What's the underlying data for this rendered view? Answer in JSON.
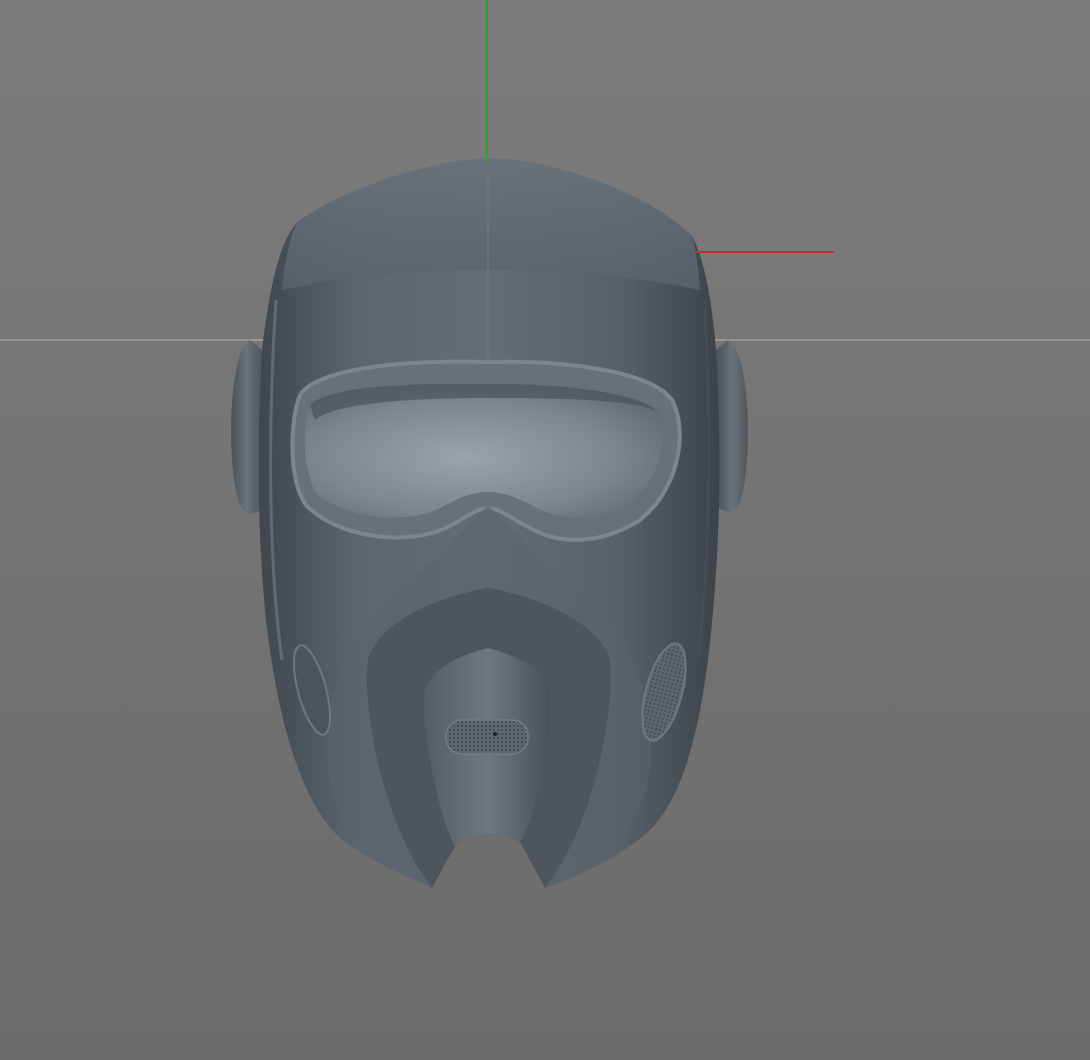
{
  "viewport": {
    "background_top": "#7c7c7c",
    "background_bottom": "#6b6b6b",
    "horizon_color": "#9c9c9c",
    "axis_y_color": "#2fa12f",
    "axis_x_color": "#c23030"
  },
  "model": {
    "object": "helmet",
    "shell_color": "#59616a",
    "shell_dark": "#3e454c",
    "shell_light": "#7a838c",
    "visor_color": "#828a93"
  }
}
